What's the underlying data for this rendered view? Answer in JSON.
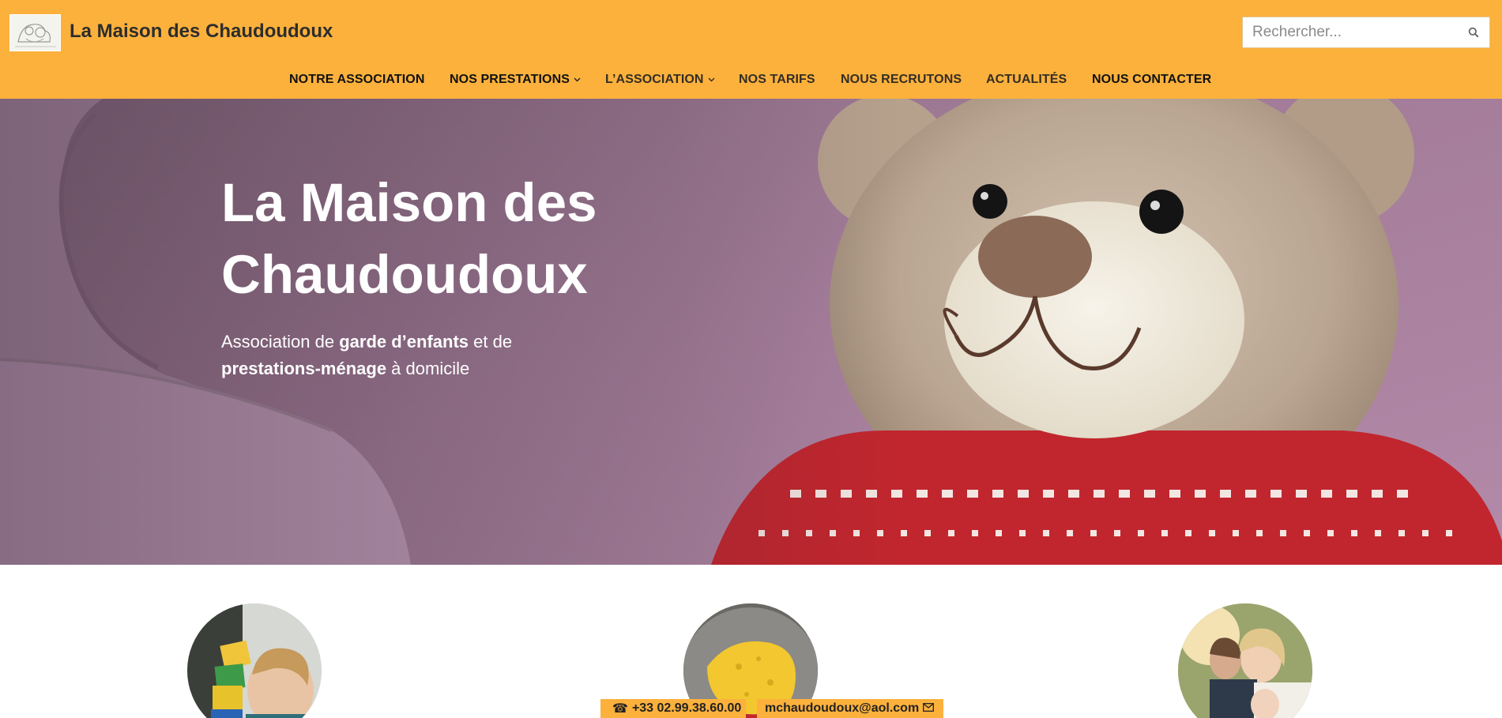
{
  "site": {
    "title": "La Maison des Chaudoudoux",
    "brand_color": "#fcb13c"
  },
  "search": {
    "placeholder": "Rechercher...",
    "icon": "search-icon"
  },
  "nav": {
    "items": [
      {
        "label": "NOTRE ASSOCIATION",
        "dropdown": false
      },
      {
        "label": "NOS PRESTATIONS",
        "dropdown": true
      },
      {
        "label": "L’ASSOCIATION",
        "dropdown": true
      },
      {
        "label": "NOS TARIFS",
        "dropdown": false
      },
      {
        "label": "NOUS RECRUTONS",
        "dropdown": false
      },
      {
        "label": "ACTUALITÉS",
        "dropdown": false
      },
      {
        "label": "NOUS CONTACTER",
        "dropdown": false
      }
    ]
  },
  "hero": {
    "title": "La Maison des Chaudoudoux",
    "subtitle": {
      "part1": "Association de ",
      "bold1": "garde d’enfants",
      "part2": " et de ",
      "bold2": "prestations-ménage",
      "part3": " à domicile"
    },
    "image": "teddy-bear-photo"
  },
  "features": {
    "images": [
      "child-blocks-photo",
      "sponge-photo",
      "family-photo"
    ]
  },
  "contact": {
    "phone": "+33 02.99.38.60.00",
    "phone_icon": "phone-icon",
    "email": "mchaudoudoux@aol.com",
    "email_icon": "mail-icon"
  }
}
